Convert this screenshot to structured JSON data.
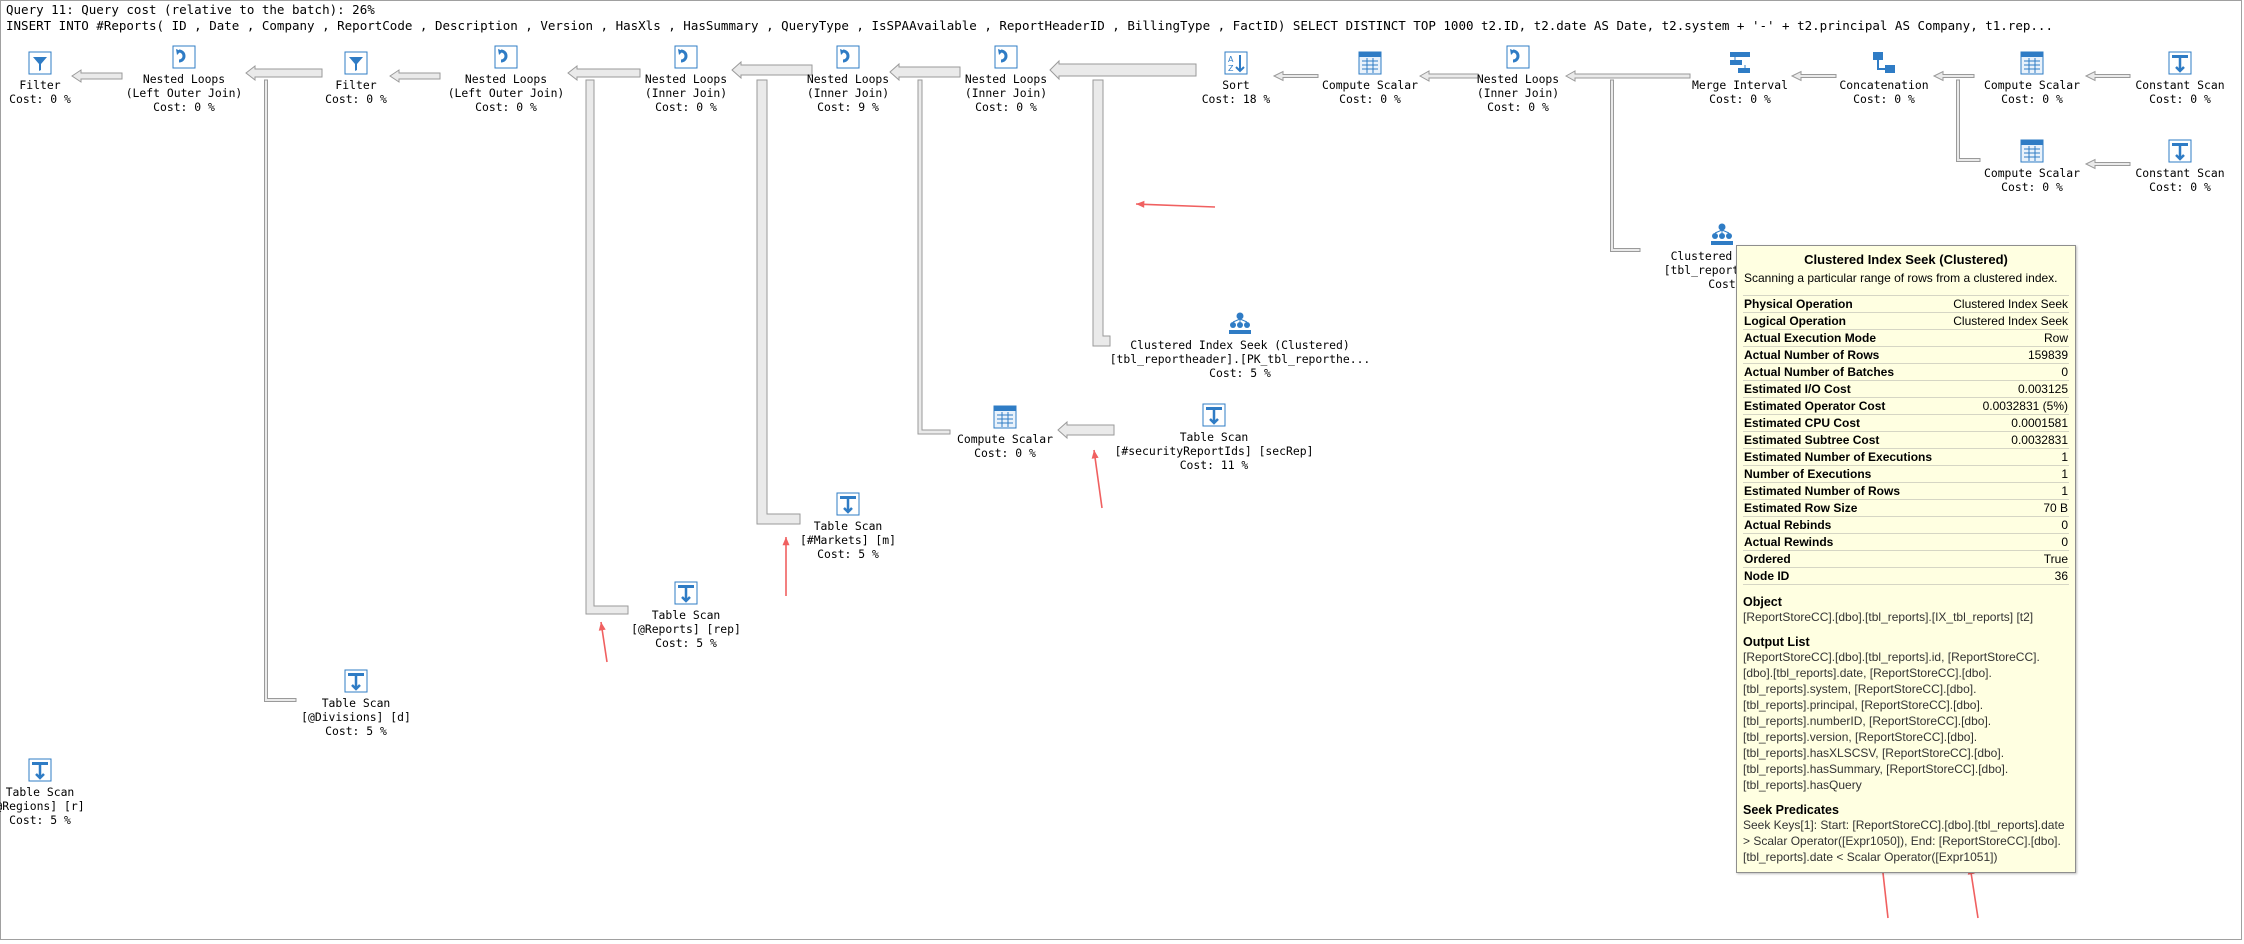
{
  "header": {
    "line1": "Query 11: Query cost (relative to the batch): 26%",
    "line2": "INSERT INTO #Reports( ID , Date , Company , ReportCode , Description , Version , HasXls , HasSummary , QueryType , IsSPAAvailable , ReportHeaderID , BillingType , FactID) SELECT DISTINCT TOP 1000 t2.ID, t2.date AS Date, t2.system + '-' + t2.principal AS Company, t1.rep..."
  },
  "nodes": [
    {
      "id": "filter1",
      "icon": "filter-icon",
      "lines": [
        "Filter",
        "Cost: 0 %"
      ]
    },
    {
      "id": "nl_loj1",
      "icon": "nested-loops-icon",
      "lines": [
        "Nested Loops",
        "(Left Outer Join)",
        "Cost: 0 %"
      ]
    },
    {
      "id": "filter2",
      "icon": "filter-icon",
      "lines": [
        "Filter",
        "Cost: 0 %"
      ]
    },
    {
      "id": "nl_loj2",
      "icon": "nested-loops-icon",
      "lines": [
        "Nested Loops",
        "(Left Outer Join)",
        "Cost: 0 %"
      ]
    },
    {
      "id": "nl_ij1",
      "icon": "nested-loops-icon",
      "lines": [
        "Nested Loops",
        "(Inner Join)",
        "Cost: 0 %"
      ]
    },
    {
      "id": "nl_ij2",
      "icon": "nested-loops-icon",
      "lines": [
        "Nested Loops",
        "(Inner Join)",
        "Cost: 9 %"
      ]
    },
    {
      "id": "nl_ij3",
      "icon": "nested-loops-icon",
      "lines": [
        "Nested Loops",
        "(Inner Join)",
        "Cost: 0 %"
      ]
    },
    {
      "id": "sort",
      "icon": "sort-icon",
      "lines": [
        "Sort",
        "Cost: 18 %"
      ]
    },
    {
      "id": "cs1",
      "icon": "compute-scalar-icon",
      "lines": [
        "Compute Scalar",
        "Cost: 0 %"
      ]
    },
    {
      "id": "nl_ij4",
      "icon": "nested-loops-icon",
      "lines": [
        "Nested Loops",
        "(Inner Join)",
        "Cost: 0 %"
      ]
    },
    {
      "id": "merge",
      "icon": "merge-interval-icon",
      "lines": [
        "Merge Interval",
        "Cost: 0 %"
      ]
    },
    {
      "id": "concat",
      "icon": "concatenation-icon",
      "lines": [
        "Concatenation",
        "Cost: 0 %"
      ]
    },
    {
      "id": "cs2",
      "icon": "compute-scalar-icon",
      "lines": [
        "Compute Scalar",
        "Cost: 0 %"
      ]
    },
    {
      "id": "const1",
      "icon": "constant-scan-icon",
      "lines": [
        "Constant Scan",
        "Cost: 0 %"
      ]
    },
    {
      "id": "cs3",
      "icon": "compute-scalar-icon",
      "lines": [
        "Compute Scalar",
        "Cost: 0 %"
      ]
    },
    {
      "id": "const2",
      "icon": "constant-scan-icon",
      "lines": [
        "Constant Scan",
        "Cost: 0 %"
      ]
    },
    {
      "id": "cis_rh",
      "icon": "clustered-index-seek-icon",
      "lines": [
        "Clustered Index Seek (Clustered)",
        "[tbl_reportheader].[PK_tbl_reporthe...",
        "Cost: 5 %"
      ]
    },
    {
      "id": "cs4",
      "icon": "compute-scalar-icon",
      "lines": [
        "Compute Scalar",
        "Cost: 0 %"
      ]
    },
    {
      "id": "ts_sec",
      "icon": "table-scan-icon",
      "lines": [
        "Table Scan",
        "[#securityReportIds] [secRep]",
        "Cost: 11 %"
      ]
    },
    {
      "id": "ts_mkt",
      "icon": "table-scan-icon",
      "lines": [
        "Table Scan",
        "[#Markets] [m]",
        "Cost: 5 %"
      ]
    },
    {
      "id": "ts_rep",
      "icon": "table-scan-icon",
      "lines": [
        "Table Scan",
        "[@Reports] [rep]",
        "Cost: 5 %"
      ]
    },
    {
      "id": "ts_div",
      "icon": "table-scan-icon",
      "lines": [
        "Table Scan",
        "[@Divisions] [d]",
        "Cost: 5 %"
      ]
    },
    {
      "id": "ts_reg",
      "icon": "table-scan-icon",
      "lines": [
        "Table Scan",
        "@Regions] [r]",
        "Cost: 5 %"
      ]
    },
    {
      "id": "cis_rep",
      "icon": "clustered-index-seek-icon",
      "lines": [
        "Clustered Index",
        "[tbl_reports].[IX",
        "Cost"
      ]
    }
  ],
  "tooltip": {
    "title": "Clustered Index Seek (Clustered)",
    "description": "Scanning a particular range of rows from a clustered index.",
    "rows": [
      {
        "k": "Physical Operation",
        "v": "Clustered Index Seek"
      },
      {
        "k": "Logical Operation",
        "v": "Clustered Index Seek"
      },
      {
        "k": "Actual Execution Mode",
        "v": "Row"
      },
      {
        "k": "Actual Number of Rows",
        "v": "159839"
      },
      {
        "k": "Actual Number of Batches",
        "v": "0"
      },
      {
        "k": "Estimated I/O Cost",
        "v": "0.003125"
      },
      {
        "k": "Estimated Operator Cost",
        "v": "0.0032831 (5%)"
      },
      {
        "k": "Estimated CPU Cost",
        "v": "0.0001581"
      },
      {
        "k": "Estimated Subtree Cost",
        "v": "0.0032831"
      },
      {
        "k": "Estimated Number of Executions",
        "v": "1"
      },
      {
        "k": "Number of Executions",
        "v": "1"
      },
      {
        "k": "Estimated Number of Rows",
        "v": "1"
      },
      {
        "k": "Estimated Row Size",
        "v": "70 B"
      },
      {
        "k": "Actual Rebinds",
        "v": "0"
      },
      {
        "k": "Actual Rewinds",
        "v": "0"
      },
      {
        "k": "Ordered",
        "v": "True"
      },
      {
        "k": "Node ID",
        "v": "36"
      }
    ],
    "object_title": "Object",
    "object_value": "[ReportStoreCC].[dbo].[tbl_reports].[IX_tbl_reports] [t2]",
    "output_title": "Output List",
    "output_lines": [
      "[ReportStoreCC].[dbo].[tbl_reports].id, [ReportStoreCC].",
      "[dbo].[tbl_reports].date, [ReportStoreCC].[dbo].",
      "[tbl_reports].system, [ReportStoreCC].[dbo].",
      "[tbl_reports].principal, [ReportStoreCC].[dbo].",
      "[tbl_reports].numberID, [ReportStoreCC].[dbo].",
      "[tbl_reports].version, [ReportStoreCC].[dbo].",
      "[tbl_reports].hasXLSCSV, [ReportStoreCC].[dbo].",
      "[tbl_reports].hasSummary, [ReportStoreCC].[dbo].",
      "[tbl_reports].hasQuery"
    ],
    "seek_title": "Seek Predicates",
    "seek_lines": [
      "Seek Keys[1]: Start: [ReportStoreCC].[dbo].[tbl_reports].date",
      "> Scalar Operator([Expr1050]), End: [ReportStoreCC].[dbo].",
      "[tbl_reports].date < Scalar Operator([Expr1051])"
    ]
  },
  "colors": {
    "icon_blue": "#2f7cc5",
    "edge_fill": "#eaeaea",
    "edge_stroke": "#9a9a9a",
    "annotation_arrow": "#f06060",
    "tooltip_bg": "#ffffe1"
  }
}
